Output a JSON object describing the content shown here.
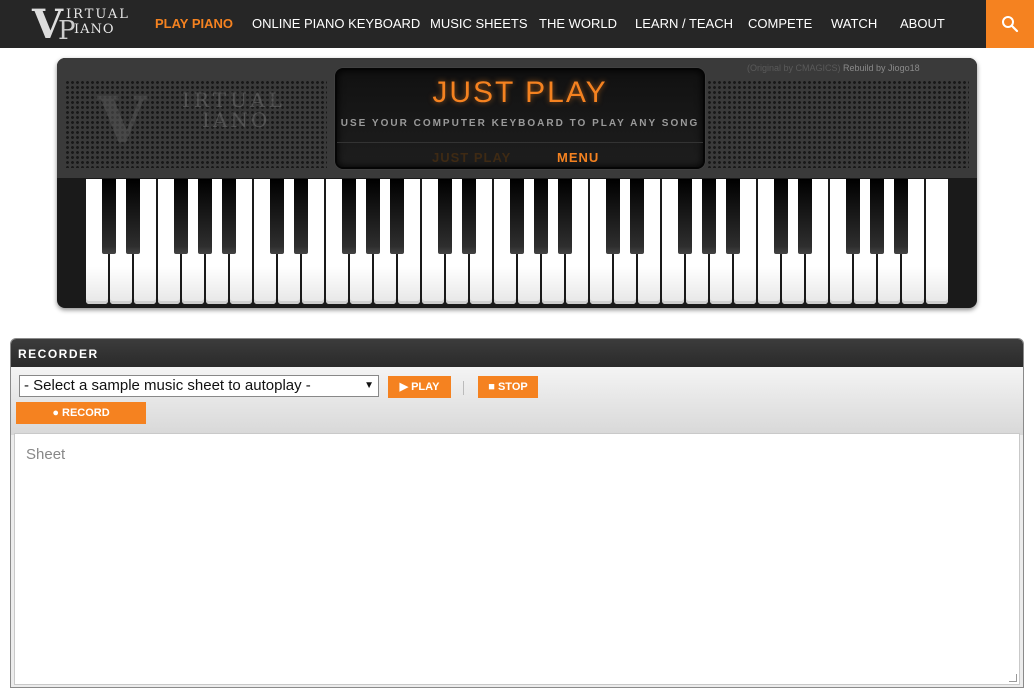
{
  "nav": {
    "logo": {
      "top": "IRTUAL",
      "bottom": "IANO"
    },
    "items": [
      {
        "label": "PLAY PIANO",
        "active": true
      },
      {
        "label": "ONLINE PIANO KEYBOARD"
      },
      {
        "label": "MUSIC SHEETS"
      },
      {
        "label": "THE WORLD"
      },
      {
        "label": "LEARN / TEACH"
      },
      {
        "label": "COMPETE"
      },
      {
        "label": "WATCH"
      },
      {
        "label": "ABOUT"
      }
    ],
    "search_icon": "search-icon"
  },
  "piano": {
    "credit_original": "(Original by CMAGICS)",
    "credit_rebuild": "Rebuild by Jiogo18",
    "display_title": "JUST PLAY",
    "display_subtitle": "USE YOUR COMPUTER KEYBOARD TO PLAY ANY SONG",
    "tab_just_play": "JUST PLAY",
    "tab_menu": "MENU",
    "white_key_count": 36,
    "octaves": 5
  },
  "recorder": {
    "title": "RECORDER",
    "select_value": "- Select a sample music sheet to autoplay -",
    "play_label": "▶ PLAY",
    "stop_label": "■ STOP",
    "record_label": "● RECORD",
    "sheet_placeholder": "Sheet"
  },
  "colors": {
    "accent": "#f58220",
    "nav_bg": "#262626"
  }
}
